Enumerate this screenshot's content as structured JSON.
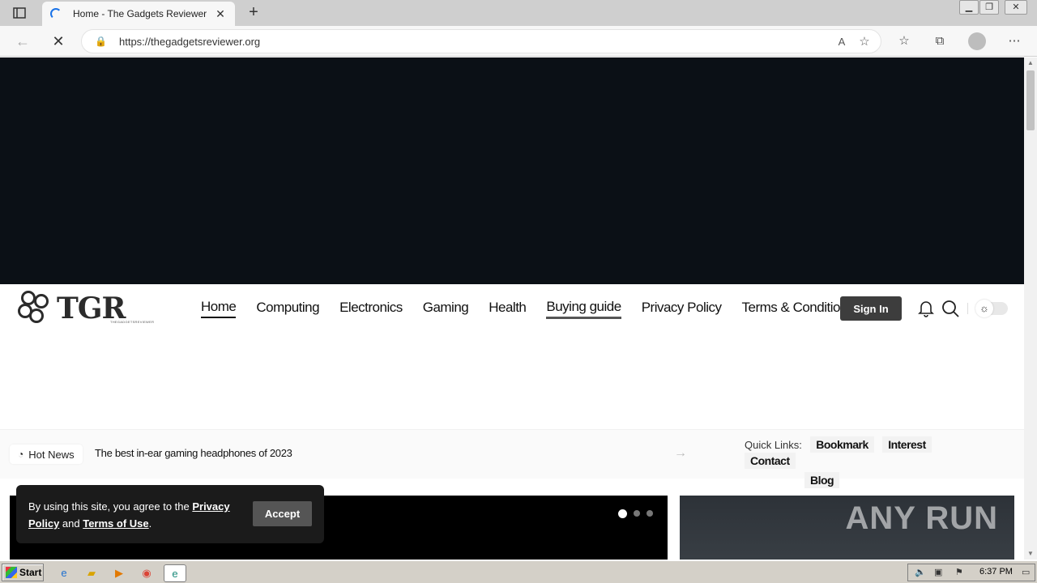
{
  "browser": {
    "tab_title": "Home - The Gadgets Reviewer",
    "url": "https://thegadgetsreviewer.org"
  },
  "site": {
    "logo_text": "TGR",
    "logo_tagline": "THEGADGETSREVIEWER",
    "nav": [
      {
        "label": "Home"
      },
      {
        "label": "Computing"
      },
      {
        "label": "Electronics"
      },
      {
        "label": "Gaming"
      },
      {
        "label": "Health"
      },
      {
        "label": "Buying guide"
      },
      {
        "label": "Privacy Policy"
      },
      {
        "label": "Terms & Conditions"
      }
    ],
    "signin_label": "Sign In"
  },
  "newsbar": {
    "hot_label": "Hot News",
    "headline": "The best in-ear gaming headphones of 2023",
    "quick_label": "Quick Links:",
    "quick_links": [
      "Bookmark",
      "Interest",
      "Contact",
      "Blog"
    ]
  },
  "cookie": {
    "text_prefix": "By using this site, you agree to the ",
    "privacy": "Privacy Policy",
    "and": " and ",
    "terms": "Terms of Use",
    "suffix": ".",
    "accept_label": "Accept"
  },
  "watermark": "ANY RUN",
  "taskbar": {
    "start_label": "Start",
    "clock": "6:37 PM"
  }
}
